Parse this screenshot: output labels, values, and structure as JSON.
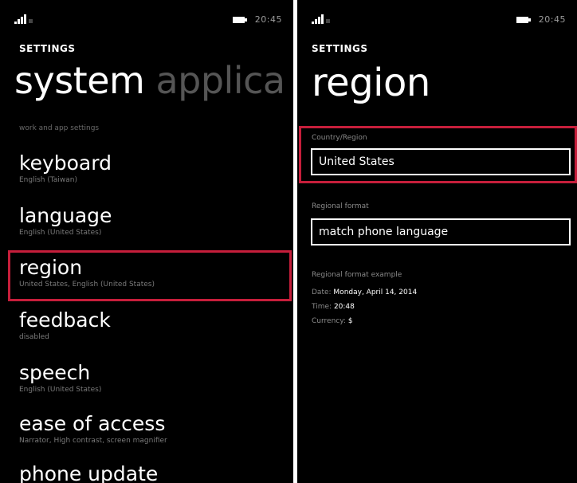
{
  "left_screen": {
    "status": {
      "time": "20:45"
    },
    "app_title": "SETTINGS",
    "pivot": {
      "active": "system",
      "next": "applica"
    },
    "section_hint": "work and app settings",
    "items": [
      {
        "title": "keyboard",
        "subtitle": "English (Taiwan)"
      },
      {
        "title": "language",
        "subtitle": "English (United States)"
      },
      {
        "title": "region",
        "subtitle": "United States, English (United States)"
      },
      {
        "title": "feedback",
        "subtitle": "disabled"
      },
      {
        "title": "speech",
        "subtitle": "English (United States)"
      },
      {
        "title": "ease of access",
        "subtitle": "Narrator, High contrast, screen magnifier"
      },
      {
        "title": "phone update",
        "subtitle": ""
      }
    ]
  },
  "right_screen": {
    "status": {
      "time": "20:45"
    },
    "app_title": "SETTINGS",
    "page_title": "region",
    "country_label": "Country/Region",
    "country_value": "United States",
    "format_label": "Regional format",
    "format_value": "match phone language",
    "example_label": "Regional format example",
    "example": {
      "date_label": "Date:",
      "date_value": "Monday, April 14, 2014",
      "time_label": "Time:",
      "time_value": "20:48",
      "currency_label": "Currency:",
      "currency_value": "$"
    }
  },
  "colors": {
    "background": "#000000",
    "highlight": "#c61e3b",
    "text": "#ffffff",
    "subtext": "#7a7a7a"
  }
}
